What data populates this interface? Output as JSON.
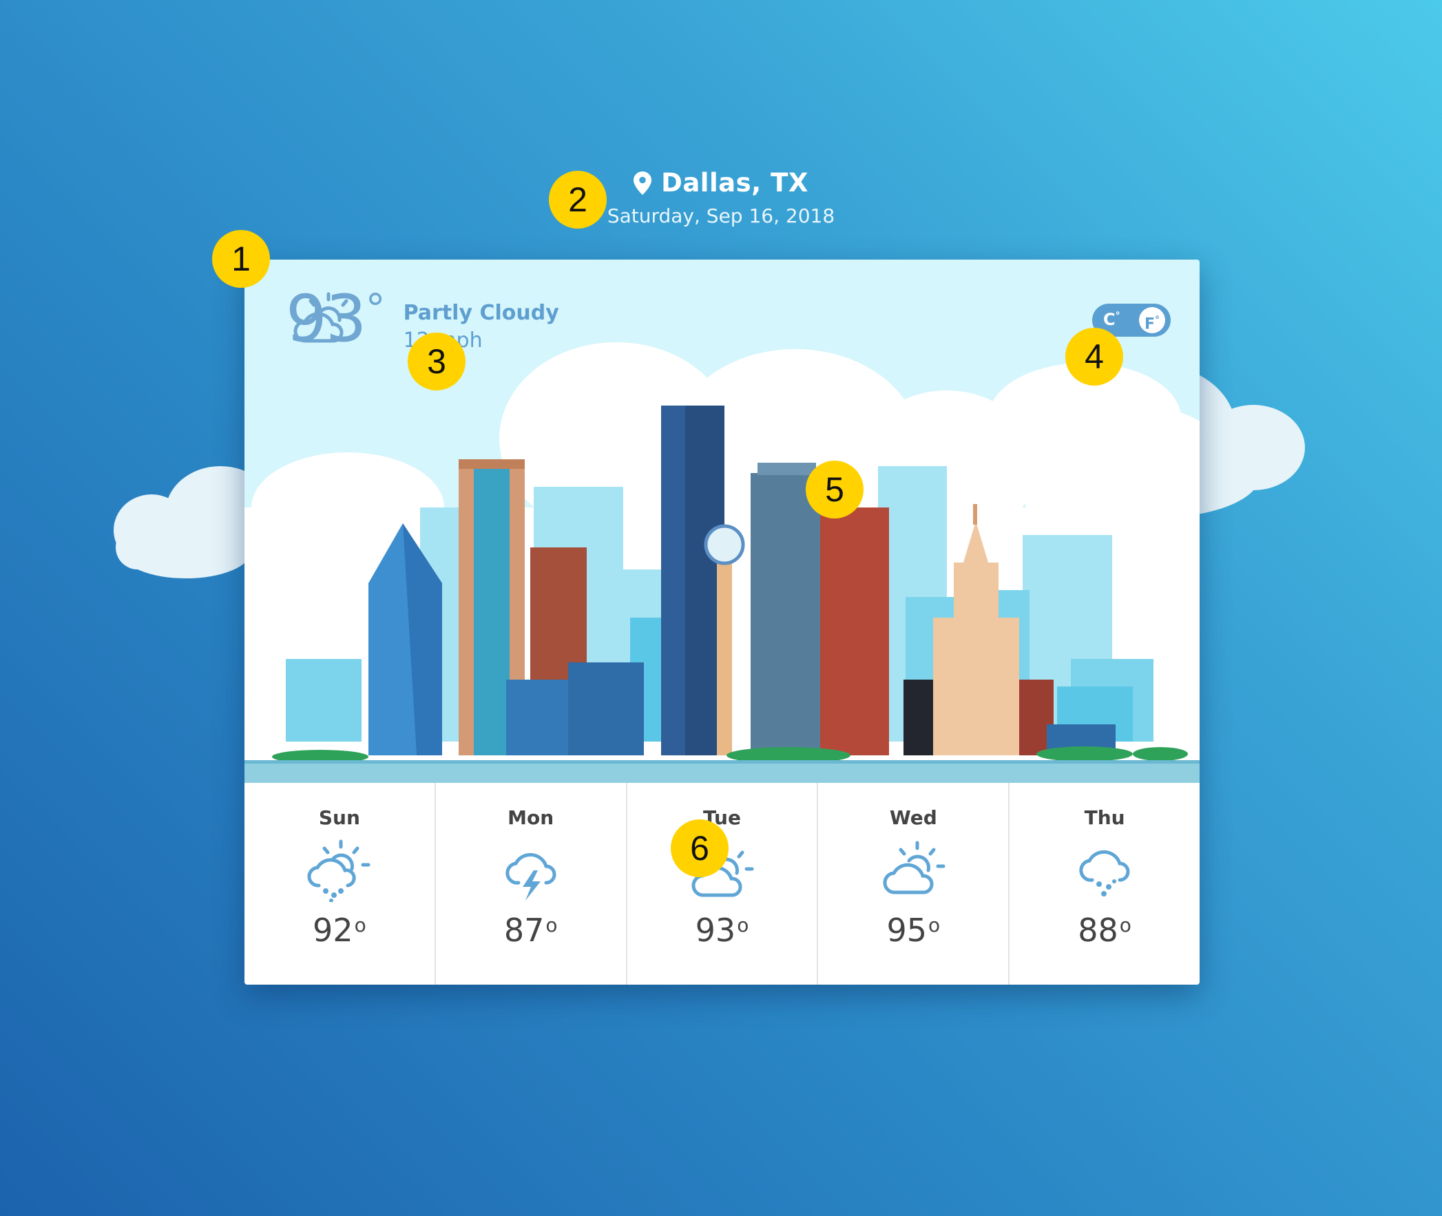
{
  "header": {
    "location": "Dallas, TX",
    "date": "Saturday, Sep 16, 2018"
  },
  "current": {
    "temperature": "93",
    "degree_symbol": "°",
    "condition": "Partly Cloudy",
    "wind": "12 mph",
    "icon": "partly-cloudy-icon"
  },
  "unit_toggle": {
    "celsius_label": "C",
    "fahrenheit_label": "F",
    "selected": "F"
  },
  "forecast": [
    {
      "day": "Sun",
      "temp": "92",
      "icon": "sun-cloud-rain-icon"
    },
    {
      "day": "Mon",
      "temp": "87",
      "icon": "thunderstorm-icon"
    },
    {
      "day": "Tue",
      "temp": "93",
      "icon": "partly-cloudy-icon"
    },
    {
      "day": "Wed",
      "temp": "95",
      "icon": "partly-cloudy-icon"
    },
    {
      "day": "Thu",
      "temp": "88",
      "icon": "rain-icon"
    }
  ],
  "callouts": [
    "1",
    "2",
    "3",
    "4",
    "5",
    "6"
  ],
  "colors": {
    "accent": "#5a9fd1",
    "icon_blue": "#5fa6d6",
    "badge_yellow": "#ffd200",
    "sky": "#d5f6fc"
  }
}
